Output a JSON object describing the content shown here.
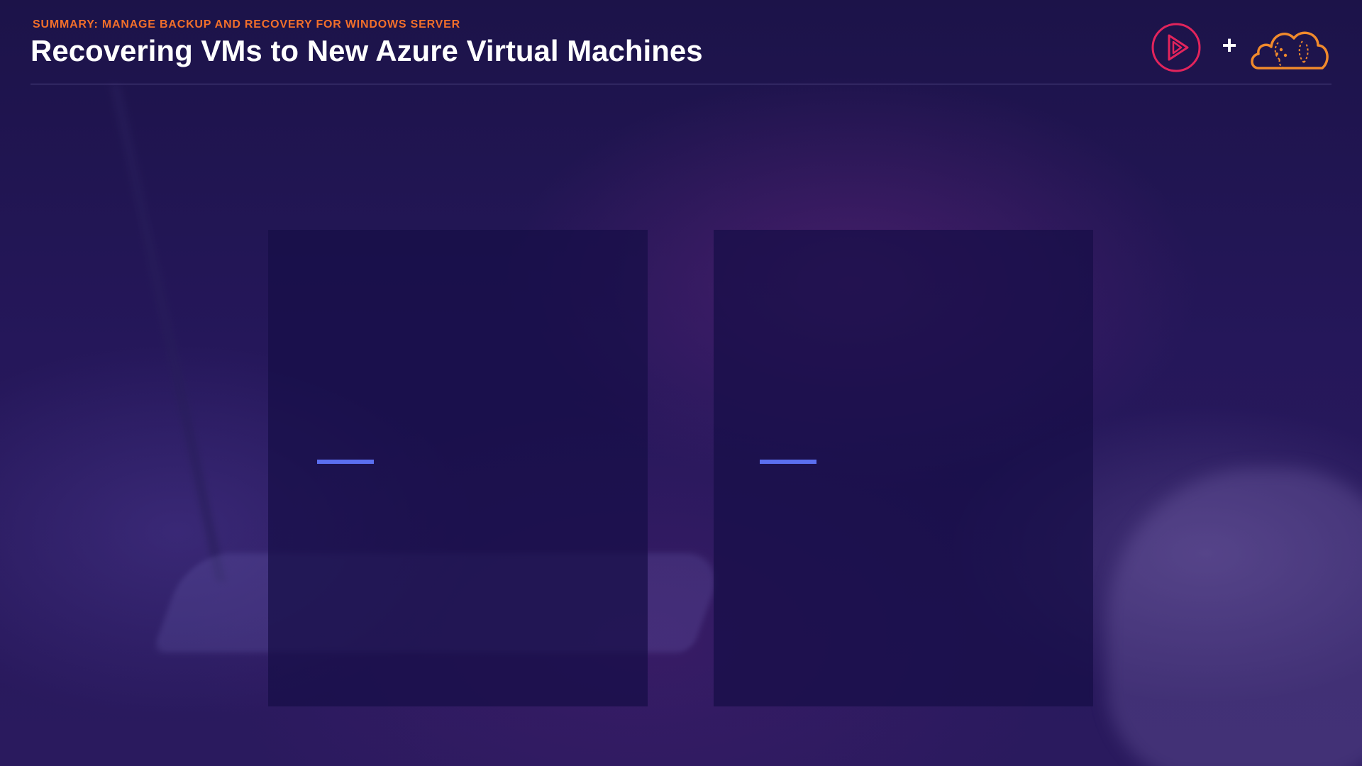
{
  "header": {
    "kicker": "SUMMARY: MANAGE BACKUP AND RECOVERY FOR WINDOWS SERVER",
    "title": "Recovering VMs to New Azure Virtual Machines",
    "plus": "+"
  },
  "logos": {
    "left_icon": "play-circle-icon",
    "right_icon": "cloud-brain-icon"
  },
  "colors": {
    "kicker": "#f36f2a",
    "title": "#ffffff",
    "accent": "#5b6ff0",
    "play_logo": "#e2245c",
    "cloud_logo": "#f08a2c",
    "background": "#25175a"
  },
  "panels": [
    {
      "id": "left"
    },
    {
      "id": "right"
    }
  ]
}
